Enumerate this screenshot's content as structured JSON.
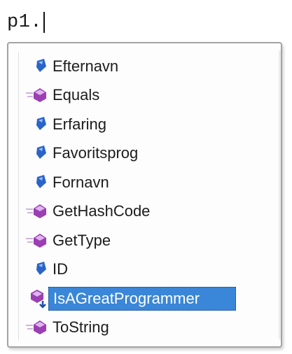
{
  "editor": {
    "text": "p1."
  },
  "completion_list": {
    "items": [
      {
        "label": "Efternavn",
        "kind": "property",
        "icon": "property-icon"
      },
      {
        "label": "Equals",
        "kind": "method",
        "icon": "method-icon"
      },
      {
        "label": "Erfaring",
        "kind": "property",
        "icon": "property-icon"
      },
      {
        "label": "Favoritsprog",
        "kind": "property",
        "icon": "property-icon"
      },
      {
        "label": "Fornavn",
        "kind": "property",
        "icon": "property-icon"
      },
      {
        "label": "GetHashCode",
        "kind": "method",
        "icon": "method-icon"
      },
      {
        "label": "GetType",
        "kind": "method",
        "icon": "method-icon"
      },
      {
        "label": "ID",
        "kind": "property",
        "icon": "property-icon"
      },
      {
        "label": "IsAGreatProgrammer",
        "kind": "extension-method",
        "icon": "extension-method-icon",
        "selected": true
      },
      {
        "label": "ToString",
        "kind": "method",
        "icon": "method-icon"
      }
    ]
  },
  "colors": {
    "selection": "#3a86d8",
    "property_icon": "#2b64c8",
    "method_icon": "#9b3fb3"
  }
}
